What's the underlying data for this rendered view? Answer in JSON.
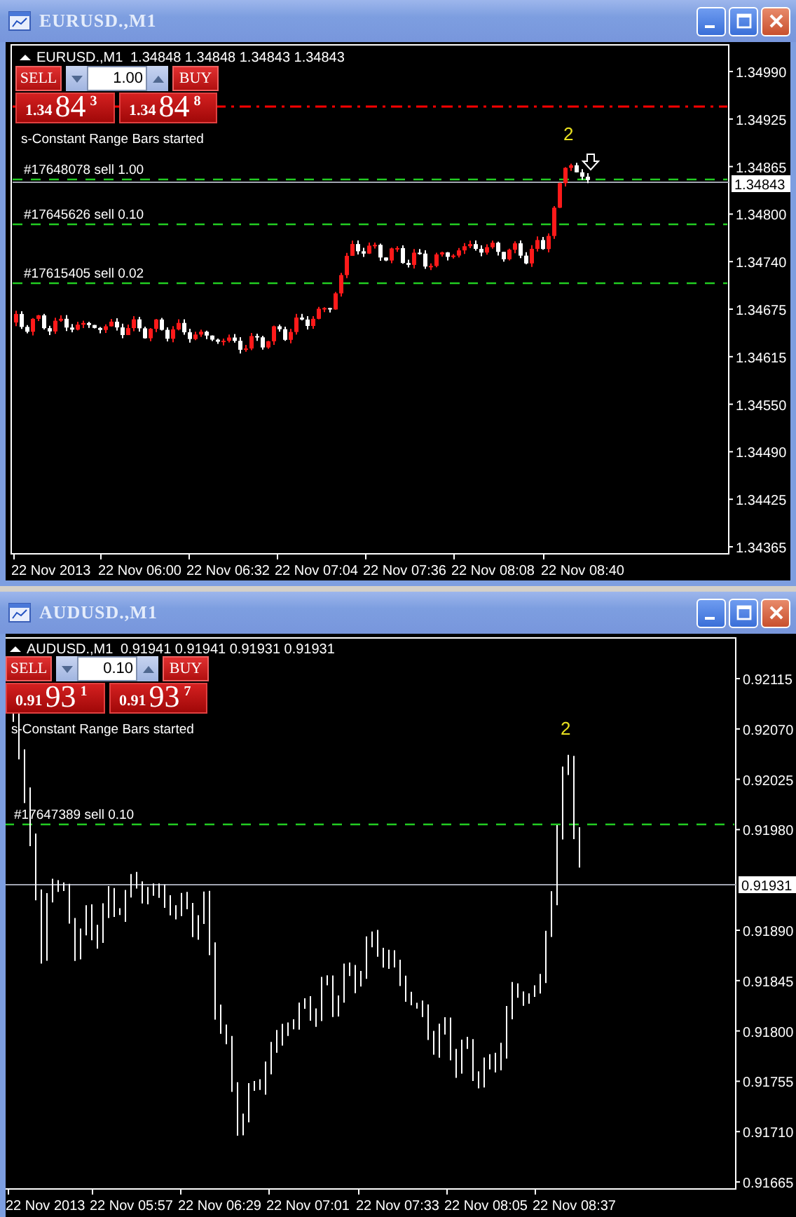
{
  "windows": [
    {
      "title": "EURUSD.,M1",
      "symbol": "EURUSD.,M1",
      "ohlc": "1.34848 1.34848 1.34843 1.34843",
      "trade_panel": {
        "sell_label": "SELL",
        "buy_label": "BUY",
        "volume": "1.00",
        "bid": {
          "prefix": "1.34",
          "big": "84",
          "pip": "3"
        },
        "ask": {
          "prefix": "1.34",
          "big": "84",
          "pip": "8"
        }
      },
      "status_text": "s-Constant Range Bars started",
      "orders": [
        {
          "label": "#17648078 sell 1.00"
        },
        {
          "label": "#17645626 sell 0.10"
        },
        {
          "label": "#17615405 sell 0.02"
        }
      ],
      "marker_label": "2",
      "price_axis": [
        "1.34990",
        "1.34925",
        "1.34865",
        "1.34800",
        "1.34740",
        "1.34675",
        "1.34615",
        "1.34550",
        "1.34490",
        "1.34425",
        "1.34365"
      ],
      "current_price": "1.34843",
      "time_axis": [
        "22 Nov 2013",
        "22 Nov 06:00",
        "22 Nov 06:32",
        "22 Nov 07:04",
        "22 Nov 07:36",
        "22 Nov 08:08",
        "22 Nov 08:40"
      ]
    },
    {
      "title": "AUDUSD.,M1",
      "symbol": "AUDUSD.,M1",
      "ohlc": "0.91941 0.91941 0.91931 0.91931",
      "trade_panel": {
        "sell_label": "SELL",
        "buy_label": "BUY",
        "volume": "0.10",
        "bid": {
          "prefix": "0.91",
          "big": "93",
          "pip": "1"
        },
        "ask": {
          "prefix": "0.91",
          "big": "93",
          "pip": "7"
        }
      },
      "status_text": "s-Constant Range Bars started",
      "orders": [
        {
          "label": "#17647389 sell 0.10"
        }
      ],
      "marker_label": "2",
      "price_axis": [
        "0.92115",
        "0.92070",
        "0.92025",
        "0.91980",
        "0.91890",
        "0.91845",
        "0.91800",
        "0.91755",
        "0.91710",
        "0.91665"
      ],
      "current_price": "0.91931",
      "time_axis": [
        "22 Nov 2013",
        "22 Nov 05:57",
        "22 Nov 06:29",
        "22 Nov 07:01",
        "22 Nov 07:33",
        "22 Nov 08:05",
        "22 Nov 08:37"
      ]
    }
  ]
}
